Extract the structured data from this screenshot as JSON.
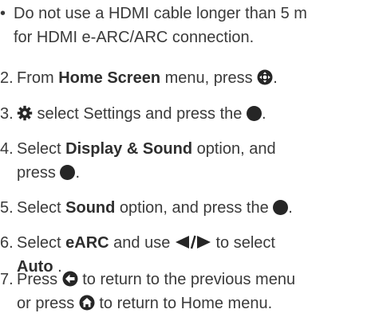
{
  "bullet": {
    "mark": "•",
    "line1": "Do not use a HDMI cable longer than 5 m",
    "line2": "for HDMI e-ARC/ARC connection."
  },
  "steps": [
    {
      "number": "2.",
      "pre": "From ",
      "bold": "Home Screen",
      "post": " menu, press ",
      "icon": "dpad-icon",
      "end": "."
    },
    {
      "number": "3.",
      "icon": "gear-icon",
      "text": " select Settings and press the ",
      "icon2": "ok-dot-icon",
      "end": "."
    },
    {
      "number": "4.",
      "pre": "Select ",
      "bold": "Display & Sound",
      "post": " option, and",
      "line2": "press ",
      "icon": "ok-dot-icon",
      "end": "."
    },
    {
      "number": "5.",
      "pre": "Select ",
      "bold": "Sound",
      "post": " option, and press the ",
      "icon": "ok-dot-icon",
      "end": "."
    },
    {
      "number": "6.",
      "pre": "Select ",
      "bold": "eARC",
      "post": " and use ",
      "icon": "left-right-arrows-icon",
      "post2": " to select",
      "line2_bold": "Auto",
      "line2_end": " ."
    },
    {
      "number": "7.",
      "pre": "Press ",
      "icon": "back-icon",
      "post": " to return to the previous menu",
      "line2_pre": "or press ",
      "icon2": "home-icon",
      "line2_post": " to return to Home menu."
    }
  ],
  "colors": {
    "text": "#3a3a3a",
    "icon": "#262626"
  }
}
